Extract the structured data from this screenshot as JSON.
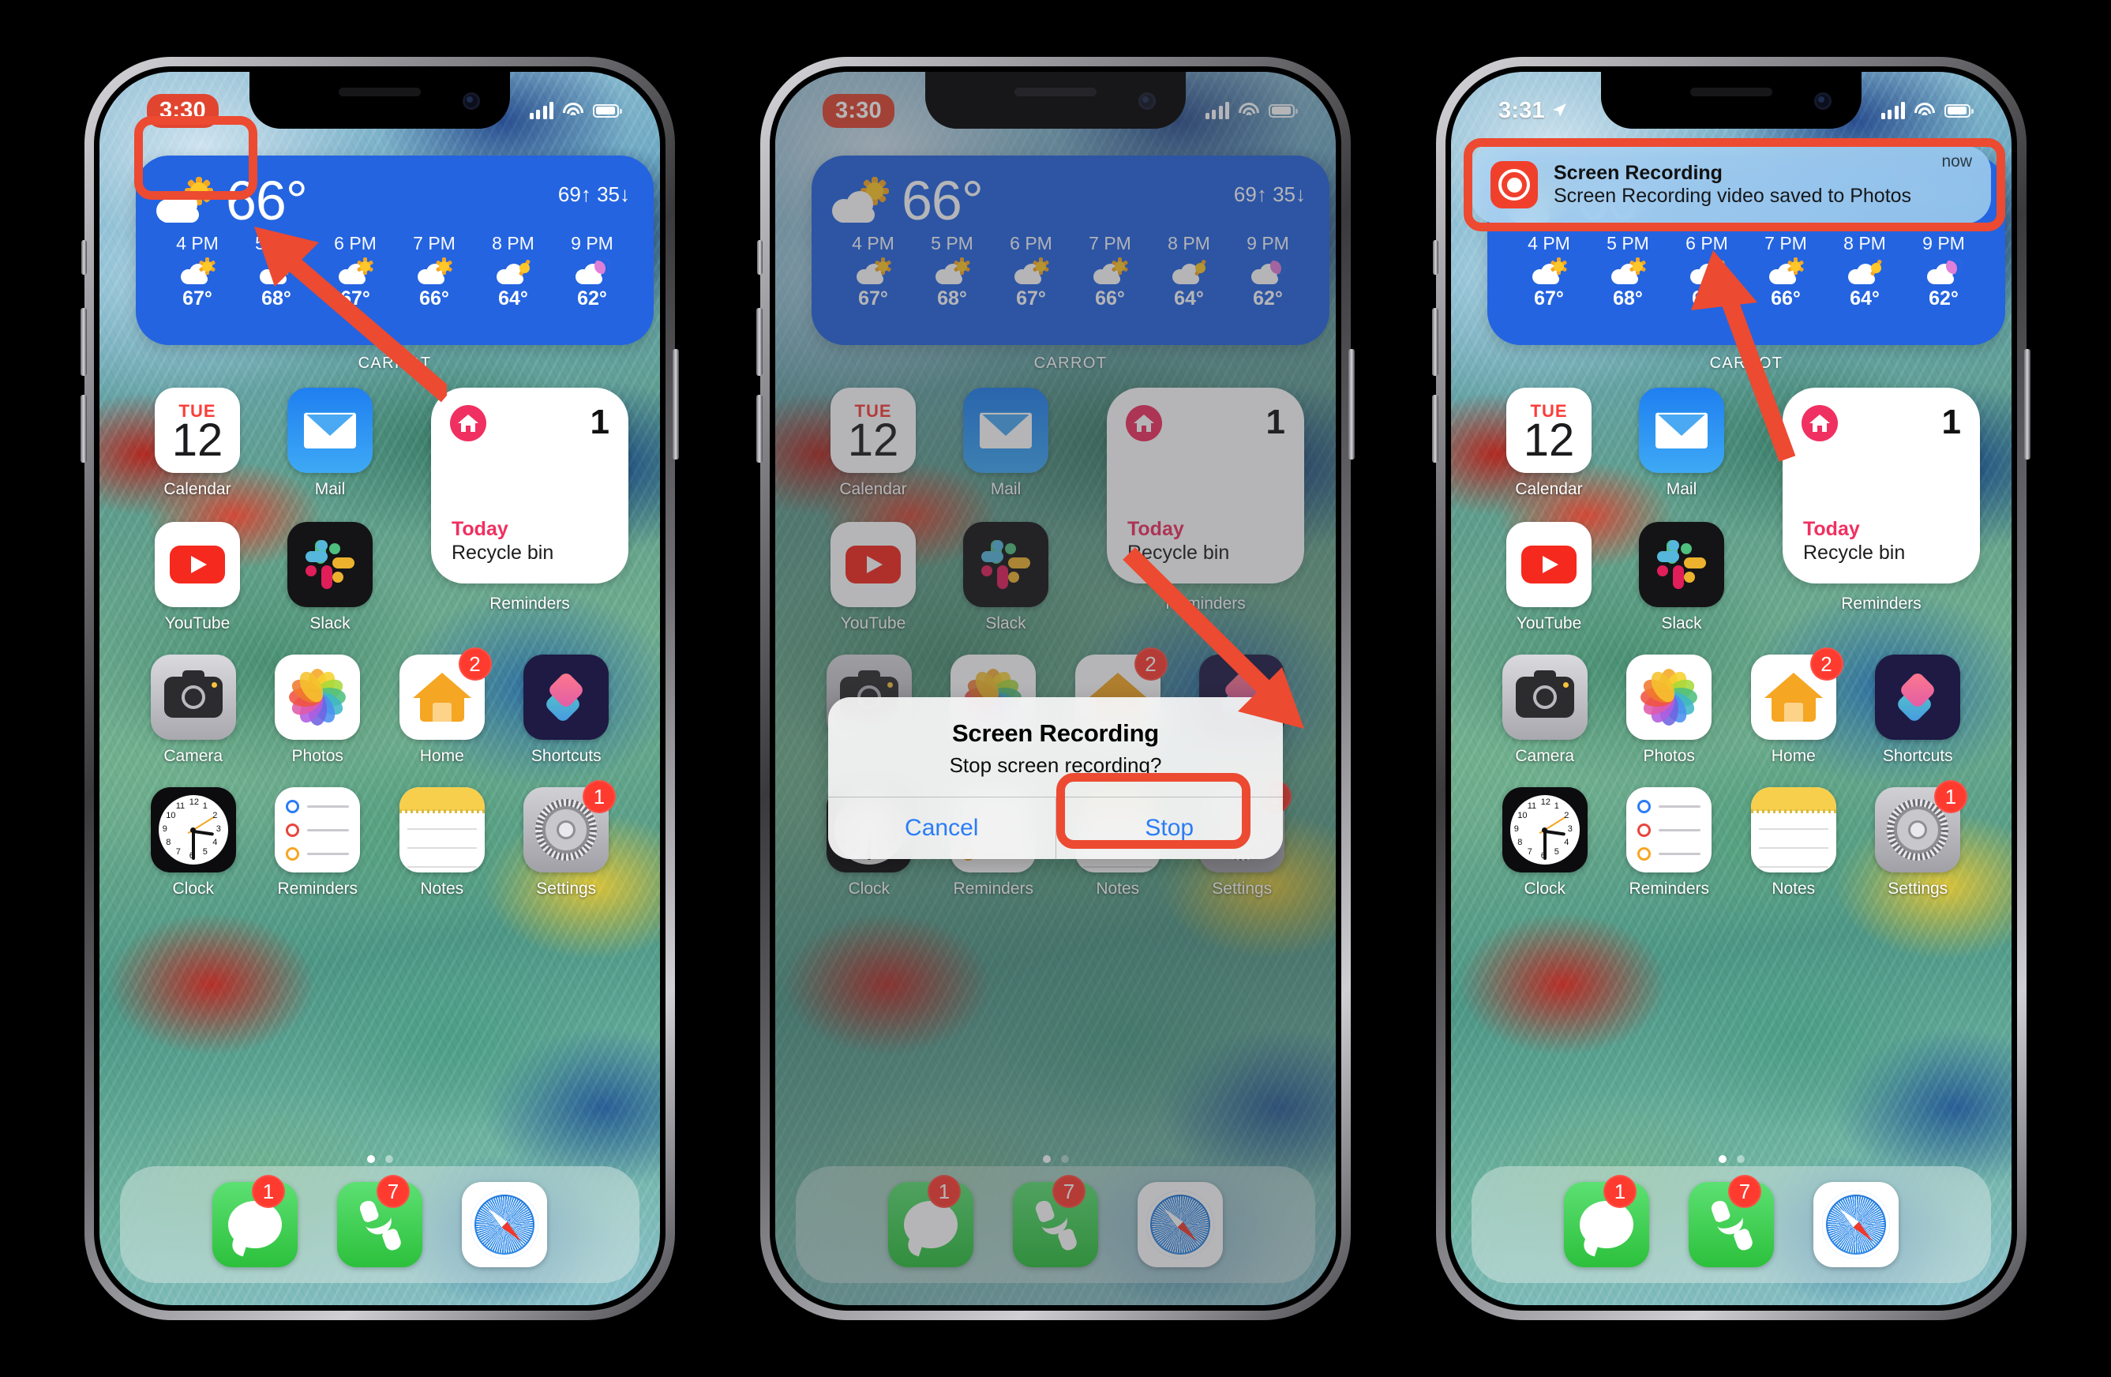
{
  "phones": [
    {
      "id": "phone-1",
      "status": {
        "time": "3:30",
        "time_highlighted": true,
        "location_arrow": false
      },
      "notification": null,
      "alert": null
    },
    {
      "id": "phone-2",
      "status": {
        "time": "3:30",
        "time_highlighted": true,
        "location_arrow": false
      },
      "notification": null,
      "alert": {
        "title": "Screen Recording",
        "message": "Stop screen recording?",
        "cancel_label": "Cancel",
        "confirm_label": "Stop"
      }
    },
    {
      "id": "phone-3",
      "status": {
        "time": "3:31",
        "time_highlighted": false,
        "location_arrow": true
      },
      "notification": {
        "app": "Screen Recording",
        "body": "Screen Recording video saved to Photos",
        "time": "now",
        "icon": "screen-recording-icon"
      },
      "alert": null
    }
  ],
  "weather": {
    "temp": "66°",
    "high": "69↑",
    "low": "35↓",
    "widget_label": "CARROT",
    "hours": [
      {
        "label": "4 PM",
        "temp": "67°",
        "icon": "partly-cloudy-day-icon"
      },
      {
        "label": "5 PM",
        "temp": "68°",
        "icon": "partly-cloudy-day-icon"
      },
      {
        "label": "6 PM",
        "temp": "67°",
        "icon": "partly-cloudy-day-icon"
      },
      {
        "label": "7 PM",
        "temp": "66°",
        "icon": "partly-cloudy-day-icon"
      },
      {
        "label": "8 PM",
        "temp": "64°",
        "icon": "mostly-cloudy-icon"
      },
      {
        "label": "9 PM",
        "temp": "62°",
        "icon": "partly-cloudy-night-icon"
      }
    ]
  },
  "reminders_widget": {
    "count": "1",
    "list_title": "Today",
    "task": "Recycle bin",
    "widget_label": "Reminders",
    "icon": "home-circle-icon",
    "accent": "#f03060"
  },
  "calendar_icon": {
    "dow": "TUE",
    "day": "12"
  },
  "apps": {
    "row1": [
      {
        "label": "Calendar",
        "icon": "calendar-icon",
        "badge": null
      },
      {
        "label": "Mail",
        "icon": "mail-icon",
        "badge": null
      }
    ],
    "row2": [
      {
        "label": "YouTube",
        "icon": "youtube-icon",
        "badge": null
      },
      {
        "label": "Slack",
        "icon": "slack-icon",
        "badge": null
      }
    ],
    "row3": [
      {
        "label": "Camera",
        "icon": "camera-icon",
        "badge": null
      },
      {
        "label": "Photos",
        "icon": "photos-icon",
        "badge": null
      },
      {
        "label": "Home",
        "icon": "home-icon",
        "badge": "2"
      },
      {
        "label": "Shortcuts",
        "icon": "shortcuts-icon",
        "badge": null
      }
    ],
    "row4": [
      {
        "label": "Clock",
        "icon": "clock-icon",
        "badge": null
      },
      {
        "label": "Reminders",
        "icon": "reminders-icon",
        "badge": null
      },
      {
        "label": "Notes",
        "icon": "notes-icon",
        "badge": null
      },
      {
        "label": "Settings",
        "icon": "settings-icon",
        "badge": "1"
      }
    ]
  },
  "dock": [
    {
      "label": "Messages",
      "icon": "messages-icon",
      "badge": "1"
    },
    {
      "label": "Phone",
      "icon": "phone-icon",
      "badge": "7"
    },
    {
      "label": "Safari",
      "icon": "safari-icon",
      "badge": null
    }
  ],
  "page_dots": {
    "count": 2,
    "active": 0
  },
  "annotations": {
    "color": "#ec4a31",
    "items": [
      {
        "target": "phone-1-status-time",
        "type": "rect-with-arrow"
      },
      {
        "target": "phone-2-stop-button",
        "type": "rect-with-arrow"
      },
      {
        "target": "phone-3-notification",
        "type": "rect-with-arrow"
      }
    ]
  }
}
